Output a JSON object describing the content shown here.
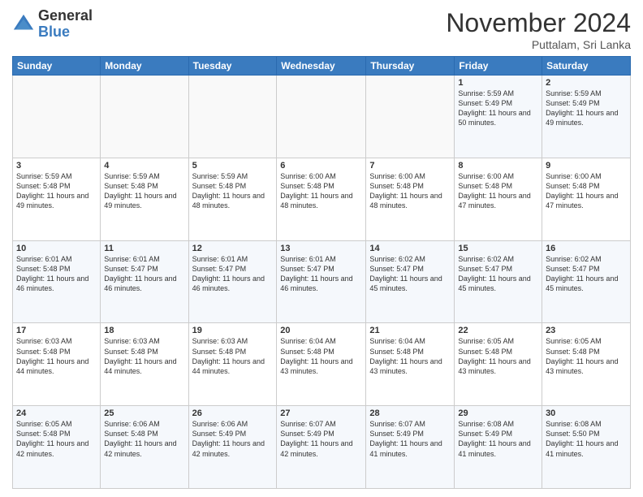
{
  "logo": {
    "general": "General",
    "blue": "Blue"
  },
  "title": "November 2024",
  "subtitle": "Puttalam, Sri Lanka",
  "days_of_week": [
    "Sunday",
    "Monday",
    "Tuesday",
    "Wednesday",
    "Thursday",
    "Friday",
    "Saturday"
  ],
  "weeks": [
    [
      {
        "day": "",
        "info": ""
      },
      {
        "day": "",
        "info": ""
      },
      {
        "day": "",
        "info": ""
      },
      {
        "day": "",
        "info": ""
      },
      {
        "day": "",
        "info": ""
      },
      {
        "day": "1",
        "info": "Sunrise: 5:59 AM\nSunset: 5:49 PM\nDaylight: 11 hours\nand 50 minutes."
      },
      {
        "day": "2",
        "info": "Sunrise: 5:59 AM\nSunset: 5:49 PM\nDaylight: 11 hours\nand 49 minutes."
      }
    ],
    [
      {
        "day": "3",
        "info": "Sunrise: 5:59 AM\nSunset: 5:48 PM\nDaylight: 11 hours\nand 49 minutes."
      },
      {
        "day": "4",
        "info": "Sunrise: 5:59 AM\nSunset: 5:48 PM\nDaylight: 11 hours\nand 49 minutes."
      },
      {
        "day": "5",
        "info": "Sunrise: 5:59 AM\nSunset: 5:48 PM\nDaylight: 11 hours\nand 48 minutes."
      },
      {
        "day": "6",
        "info": "Sunrise: 6:00 AM\nSunset: 5:48 PM\nDaylight: 11 hours\nand 48 minutes."
      },
      {
        "day": "7",
        "info": "Sunrise: 6:00 AM\nSunset: 5:48 PM\nDaylight: 11 hours\nand 48 minutes."
      },
      {
        "day": "8",
        "info": "Sunrise: 6:00 AM\nSunset: 5:48 PM\nDaylight: 11 hours\nand 47 minutes."
      },
      {
        "day": "9",
        "info": "Sunrise: 6:00 AM\nSunset: 5:48 PM\nDaylight: 11 hours\nand 47 minutes."
      }
    ],
    [
      {
        "day": "10",
        "info": "Sunrise: 6:01 AM\nSunset: 5:48 PM\nDaylight: 11 hours\nand 46 minutes."
      },
      {
        "day": "11",
        "info": "Sunrise: 6:01 AM\nSunset: 5:47 PM\nDaylight: 11 hours\nand 46 minutes."
      },
      {
        "day": "12",
        "info": "Sunrise: 6:01 AM\nSunset: 5:47 PM\nDaylight: 11 hours\nand 46 minutes."
      },
      {
        "day": "13",
        "info": "Sunrise: 6:01 AM\nSunset: 5:47 PM\nDaylight: 11 hours\nand 46 minutes."
      },
      {
        "day": "14",
        "info": "Sunrise: 6:02 AM\nSunset: 5:47 PM\nDaylight: 11 hours\nand 45 minutes."
      },
      {
        "day": "15",
        "info": "Sunrise: 6:02 AM\nSunset: 5:47 PM\nDaylight: 11 hours\nand 45 minutes."
      },
      {
        "day": "16",
        "info": "Sunrise: 6:02 AM\nSunset: 5:47 PM\nDaylight: 11 hours\nand 45 minutes."
      }
    ],
    [
      {
        "day": "17",
        "info": "Sunrise: 6:03 AM\nSunset: 5:48 PM\nDaylight: 11 hours\nand 44 minutes."
      },
      {
        "day": "18",
        "info": "Sunrise: 6:03 AM\nSunset: 5:48 PM\nDaylight: 11 hours\nand 44 minutes."
      },
      {
        "day": "19",
        "info": "Sunrise: 6:03 AM\nSunset: 5:48 PM\nDaylight: 11 hours\nand 44 minutes."
      },
      {
        "day": "20",
        "info": "Sunrise: 6:04 AM\nSunset: 5:48 PM\nDaylight: 11 hours\nand 43 minutes."
      },
      {
        "day": "21",
        "info": "Sunrise: 6:04 AM\nSunset: 5:48 PM\nDaylight: 11 hours\nand 43 minutes."
      },
      {
        "day": "22",
        "info": "Sunrise: 6:05 AM\nSunset: 5:48 PM\nDaylight: 11 hours\nand 43 minutes."
      },
      {
        "day": "23",
        "info": "Sunrise: 6:05 AM\nSunset: 5:48 PM\nDaylight: 11 hours\nand 43 minutes."
      }
    ],
    [
      {
        "day": "24",
        "info": "Sunrise: 6:05 AM\nSunset: 5:48 PM\nDaylight: 11 hours\nand 42 minutes."
      },
      {
        "day": "25",
        "info": "Sunrise: 6:06 AM\nSunset: 5:48 PM\nDaylight: 11 hours\nand 42 minutes."
      },
      {
        "day": "26",
        "info": "Sunrise: 6:06 AM\nSunset: 5:49 PM\nDaylight: 11 hours\nand 42 minutes."
      },
      {
        "day": "27",
        "info": "Sunrise: 6:07 AM\nSunset: 5:49 PM\nDaylight: 11 hours\nand 42 minutes."
      },
      {
        "day": "28",
        "info": "Sunrise: 6:07 AM\nSunset: 5:49 PM\nDaylight: 11 hours\nand 41 minutes."
      },
      {
        "day": "29",
        "info": "Sunrise: 6:08 AM\nSunset: 5:49 PM\nDaylight: 11 hours\nand 41 minutes."
      },
      {
        "day": "30",
        "info": "Sunrise: 6:08 AM\nSunset: 5:50 PM\nDaylight: 11 hours\nand 41 minutes."
      }
    ]
  ]
}
